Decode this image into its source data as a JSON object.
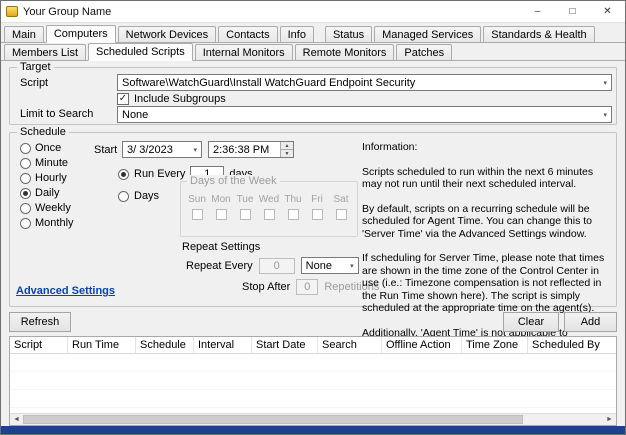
{
  "window": {
    "title": "Your Group Name"
  },
  "icons": {
    "chevron_down": "▾",
    "spin_up": "▲",
    "spin_down": "▼",
    "scroll_left": "◄",
    "scroll_right": "►",
    "check": "✓",
    "minimize": "–",
    "maximize": "□",
    "close": "✕"
  },
  "tabs_row1": [
    "Main",
    "Computers",
    "Network Devices",
    "Contacts",
    "Info",
    "Status",
    "Managed Services",
    "Standards & Health"
  ],
  "tabs_row2": [
    "Members List",
    "Scheduled Scripts",
    "Internal Monitors",
    "Remote Monitors",
    "Patches"
  ],
  "target": {
    "legend": "Target",
    "script_label": "Script",
    "script_value": "Software\\WatchGuard\\Install WatchGuard Endpoint Security",
    "include_subgroups_label": "Include Subgroups",
    "limit_label": "Limit to Search",
    "limit_value": "None"
  },
  "schedule": {
    "legend": "Schedule",
    "frequency_options": [
      "Once",
      "Minute",
      "Hourly",
      "Daily",
      "Weekly",
      "Monthly"
    ],
    "selected_frequency": "Daily",
    "start_label": "Start",
    "start_date": "3/ 3/2023",
    "start_time": "2:36:38 PM",
    "run_every_label": "Run Every",
    "run_every_value": "1",
    "run_every_unit": "days",
    "days_label": "Days",
    "days_of_week_legend": "Days of the Week",
    "days_of_week": [
      "Sun",
      "Mon",
      "Tue",
      "Wed",
      "Thu",
      "Fri",
      "Sat"
    ],
    "repeat_legend": "Repeat Settings",
    "repeat_every_label": "Repeat Every",
    "repeat_every_value": "0",
    "repeat_unit_value": "None",
    "stop_after_label": "Stop After",
    "stop_after_value": "0",
    "repetitions_label": "Repetitions",
    "advanced_settings_link": "Advanced Settings"
  },
  "info_panel": {
    "heading": "Information:",
    "paragraphs": [
      "Scripts scheduled to run within the next 6 minutes may not run until their next scheduled interval.",
      "By default, scripts on a recurring schedule will be scheduled for Agent Time. You can change this to 'Server Time' via the Advanced Settings window.",
      "If scheduling for Server Time, please note that times are shown in the time zone of the Control Center in use (i.e.: Timezone compensation is not reflected in the Run Time shown here). The script is simply scheduled at the appropriate time on the agent(s).",
      "Additionally, 'Agent Time' is not applicable to Maintenance modes. (Maintenance modes are 'Server Time')"
    ]
  },
  "actions": {
    "refresh": "Refresh",
    "clear": "Clear",
    "add": "Add"
  },
  "table": {
    "columns": [
      "Script",
      "Run Time",
      "Schedule",
      "Interval",
      "Start Date",
      "Search",
      "Offline Action",
      "Time Zone",
      "Scheduled By"
    ],
    "rows": []
  }
}
